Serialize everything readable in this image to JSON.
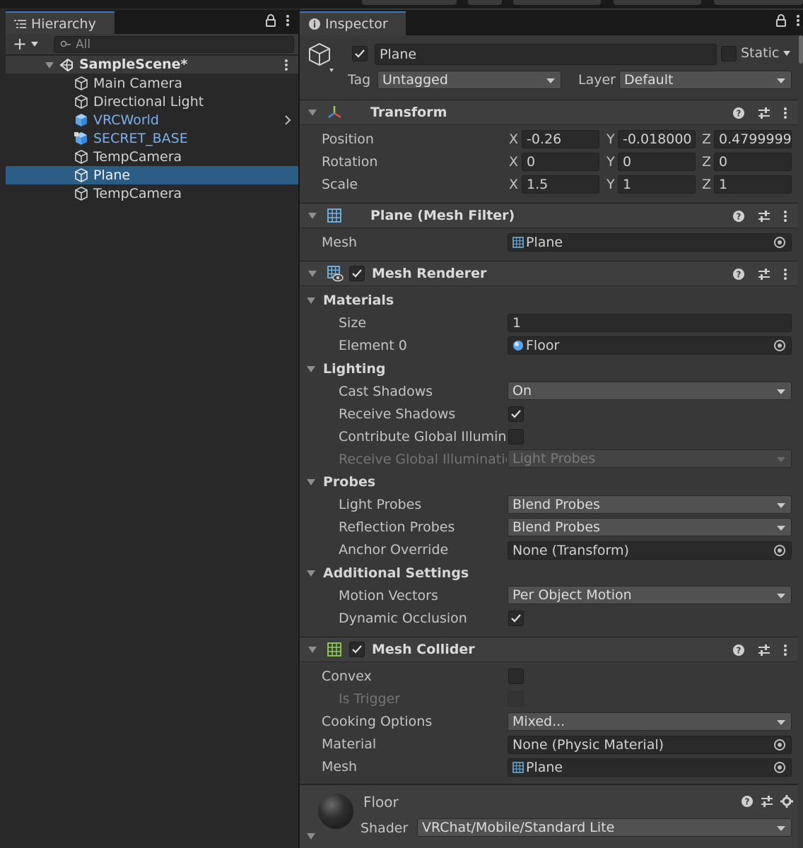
{
  "hierarchy": {
    "tab_label": "Hierarchy",
    "search_placeholder": "All",
    "scene_name": "SampleScene*",
    "items": [
      {
        "label": "Main Camera"
      },
      {
        "label": "Directional Light"
      },
      {
        "label": "VRCWorld"
      },
      {
        "label": "SECRET_BASE"
      },
      {
        "label": "TempCamera"
      },
      {
        "label": "Plane"
      },
      {
        "label": "TempCamera"
      }
    ]
  },
  "inspector": {
    "tab_label": "Inspector",
    "object_name": "Plane",
    "static_label": "Static",
    "tag_label": "Tag",
    "tag_value": "Untagged",
    "layer_label": "Layer",
    "layer_value": "Default"
  },
  "transform": {
    "title": "Transform",
    "position_label": "Position",
    "rotation_label": "Rotation",
    "scale_label": "Scale",
    "axis_x": "X",
    "axis_y": "Y",
    "axis_z": "Z",
    "position": {
      "x": "-0.26",
      "y": "-0.018000",
      "z": "0.4799999"
    },
    "rotation": {
      "x": "0",
      "y": "0",
      "z": "0"
    },
    "scale": {
      "x": "1.5",
      "y": "1",
      "z": "1"
    }
  },
  "mesh_filter": {
    "title": "Plane (Mesh Filter)",
    "mesh_label": "Mesh",
    "mesh_value": "Plane"
  },
  "mesh_renderer": {
    "title": "Mesh Renderer",
    "materials_label": "Materials",
    "size_label": "Size",
    "size_value": "1",
    "element0_label": "Element 0",
    "element0_value": "Floor",
    "lighting_label": "Lighting",
    "cast_shadows_label": "Cast Shadows",
    "cast_shadows_value": "On",
    "receive_shadows_label": "Receive Shadows",
    "contribute_gi_label": "Contribute Global Illuminat",
    "receive_gi_label": "Receive Global Illuminatio",
    "receive_gi_value": "Light Probes",
    "probes_label": "Probes",
    "light_probes_label": "Light Probes",
    "light_probes_value": "Blend Probes",
    "reflection_probes_label": "Reflection Probes",
    "reflection_probes_value": "Blend Probes",
    "anchor_override_label": "Anchor Override",
    "anchor_override_value": "None (Transform)",
    "additional_label": "Additional Settings",
    "motion_vectors_label": "Motion Vectors",
    "motion_vectors_value": "Per Object Motion",
    "dynamic_occlusion_label": "Dynamic Occlusion"
  },
  "mesh_collider": {
    "title": "Mesh Collider",
    "convex_label": "Convex",
    "is_trigger_label": "Is Trigger",
    "cooking_label": "Cooking Options",
    "cooking_value": "Mixed...",
    "material_label": "Material",
    "material_value": "None (Physic Material)",
    "mesh_label": "Mesh",
    "mesh_value": "Plane"
  },
  "material_preview": {
    "name": "Floor",
    "shader_label": "Shader",
    "shader_value": "VRChat/Mobile/Standard Lite"
  },
  "colors": {
    "selection": "#2c5d87",
    "prefab_blue": "#7bb1f2",
    "panel_bg": "#383838",
    "section_bg": "#3e3e3e",
    "accent_tab": "#3a79bb"
  }
}
